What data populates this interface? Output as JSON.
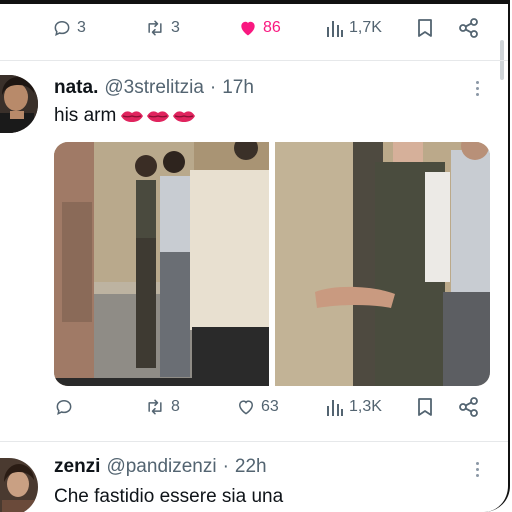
{
  "top_actions": {
    "replies": "3",
    "retweets": "3",
    "likes": "86",
    "views": "1,7K"
  },
  "tweet1": {
    "name": "nata.",
    "handle": "@3strelitzia",
    "separator": "·",
    "time": "17h",
    "text": "his arm",
    "emoji_count": 3,
    "media": [
      "photo-left",
      "photo-right"
    ],
    "actions": {
      "replies": "",
      "retweets": "8",
      "likes": "63",
      "views": "1,3K"
    }
  },
  "tweet2": {
    "name": "zenzi",
    "handle": "@pandizenzi",
    "separator": "·",
    "time": "22h",
    "text": "Che fastidio essere sia una"
  },
  "colors": {
    "text": "#0f1419",
    "secondary": "#536471",
    "like_pink": "#f91880",
    "divider": "#e6e8ea"
  },
  "icons": [
    "reply-icon",
    "retweet-icon",
    "heart-icon",
    "views-icon",
    "bookmark-icon",
    "share-icon",
    "more-icon"
  ]
}
